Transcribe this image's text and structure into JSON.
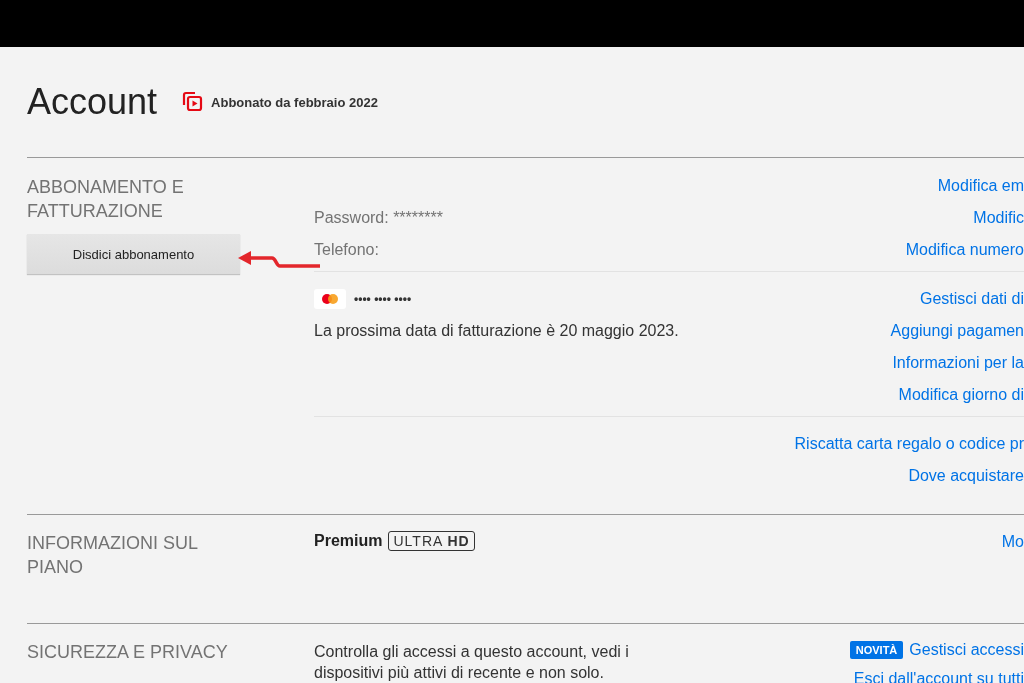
{
  "header": {
    "title": "Account",
    "member_since": "Abbonato da febbraio 2022"
  },
  "billing": {
    "title": "ABBONAMENTO E FATTURAZIONE",
    "cancel_button": "Disdici abbonamento",
    "groups": [
      {
        "rows": [
          {
            "link": "Modifica em"
          },
          {
            "text": "Password: ********",
            "link": "Modific"
          },
          {
            "text": "Telefono:",
            "link": "Modifica numero"
          }
        ]
      },
      {
        "rows": [
          {
            "card": "•••• •••• ••••",
            "link": "Gestisci dati di"
          },
          {
            "text": "La prossima data di fatturazione è 20 maggio 2023.",
            "link": "Aggiungi pagamen"
          },
          {
            "link": "Informazioni per la"
          },
          {
            "link": "Modifica giorno di"
          }
        ]
      },
      {
        "rows": [
          {
            "link": "Riscatta carta regalo o codice pr"
          },
          {
            "link": "Dove acquistare"
          }
        ]
      }
    ]
  },
  "plan": {
    "title": "INFORMAZIONI SUL PIANO",
    "name": "Premium",
    "badge": "ULTRA **HD**",
    "link": "Mo"
  },
  "security": {
    "title": "SICUREZZA E PRIVACY",
    "text": "Controlla gli accessi a questo account, vedi i dispositivi più attivi di recente e non solo.",
    "links": [
      {
        "badge": "NOVITÀ",
        "text": "Gestisci accessi"
      },
      {
        "text": "Esci dall'account su tutti"
      }
    ]
  }
}
